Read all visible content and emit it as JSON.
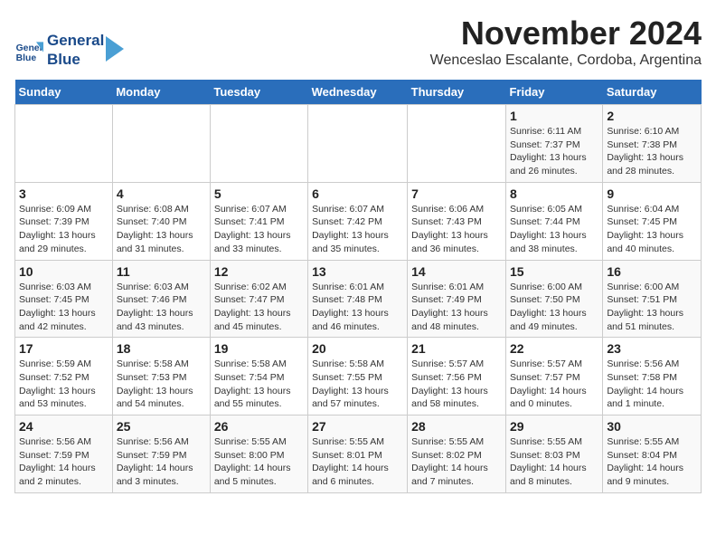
{
  "logo": {
    "line1": "General",
    "line2": "Blue"
  },
  "title": "November 2024",
  "location": "Wenceslao Escalante, Cordoba, Argentina",
  "days_of_week": [
    "Sunday",
    "Monday",
    "Tuesday",
    "Wednesday",
    "Thursday",
    "Friday",
    "Saturday"
  ],
  "weeks": [
    [
      {
        "day": "",
        "info": ""
      },
      {
        "day": "",
        "info": ""
      },
      {
        "day": "",
        "info": ""
      },
      {
        "day": "",
        "info": ""
      },
      {
        "day": "",
        "info": ""
      },
      {
        "day": "1",
        "info": "Sunrise: 6:11 AM\nSunset: 7:37 PM\nDaylight: 13 hours and 26 minutes."
      },
      {
        "day": "2",
        "info": "Sunrise: 6:10 AM\nSunset: 7:38 PM\nDaylight: 13 hours and 28 minutes."
      }
    ],
    [
      {
        "day": "3",
        "info": "Sunrise: 6:09 AM\nSunset: 7:39 PM\nDaylight: 13 hours and 29 minutes."
      },
      {
        "day": "4",
        "info": "Sunrise: 6:08 AM\nSunset: 7:40 PM\nDaylight: 13 hours and 31 minutes."
      },
      {
        "day": "5",
        "info": "Sunrise: 6:07 AM\nSunset: 7:41 PM\nDaylight: 13 hours and 33 minutes."
      },
      {
        "day": "6",
        "info": "Sunrise: 6:07 AM\nSunset: 7:42 PM\nDaylight: 13 hours and 35 minutes."
      },
      {
        "day": "7",
        "info": "Sunrise: 6:06 AM\nSunset: 7:43 PM\nDaylight: 13 hours and 36 minutes."
      },
      {
        "day": "8",
        "info": "Sunrise: 6:05 AM\nSunset: 7:44 PM\nDaylight: 13 hours and 38 minutes."
      },
      {
        "day": "9",
        "info": "Sunrise: 6:04 AM\nSunset: 7:45 PM\nDaylight: 13 hours and 40 minutes."
      }
    ],
    [
      {
        "day": "10",
        "info": "Sunrise: 6:03 AM\nSunset: 7:45 PM\nDaylight: 13 hours and 42 minutes."
      },
      {
        "day": "11",
        "info": "Sunrise: 6:03 AM\nSunset: 7:46 PM\nDaylight: 13 hours and 43 minutes."
      },
      {
        "day": "12",
        "info": "Sunrise: 6:02 AM\nSunset: 7:47 PM\nDaylight: 13 hours and 45 minutes."
      },
      {
        "day": "13",
        "info": "Sunrise: 6:01 AM\nSunset: 7:48 PM\nDaylight: 13 hours and 46 minutes."
      },
      {
        "day": "14",
        "info": "Sunrise: 6:01 AM\nSunset: 7:49 PM\nDaylight: 13 hours and 48 minutes."
      },
      {
        "day": "15",
        "info": "Sunrise: 6:00 AM\nSunset: 7:50 PM\nDaylight: 13 hours and 49 minutes."
      },
      {
        "day": "16",
        "info": "Sunrise: 6:00 AM\nSunset: 7:51 PM\nDaylight: 13 hours and 51 minutes."
      }
    ],
    [
      {
        "day": "17",
        "info": "Sunrise: 5:59 AM\nSunset: 7:52 PM\nDaylight: 13 hours and 53 minutes."
      },
      {
        "day": "18",
        "info": "Sunrise: 5:58 AM\nSunset: 7:53 PM\nDaylight: 13 hours and 54 minutes."
      },
      {
        "day": "19",
        "info": "Sunrise: 5:58 AM\nSunset: 7:54 PM\nDaylight: 13 hours and 55 minutes."
      },
      {
        "day": "20",
        "info": "Sunrise: 5:58 AM\nSunset: 7:55 PM\nDaylight: 13 hours and 57 minutes."
      },
      {
        "day": "21",
        "info": "Sunrise: 5:57 AM\nSunset: 7:56 PM\nDaylight: 13 hours and 58 minutes."
      },
      {
        "day": "22",
        "info": "Sunrise: 5:57 AM\nSunset: 7:57 PM\nDaylight: 14 hours and 0 minutes."
      },
      {
        "day": "23",
        "info": "Sunrise: 5:56 AM\nSunset: 7:58 PM\nDaylight: 14 hours and 1 minute."
      }
    ],
    [
      {
        "day": "24",
        "info": "Sunrise: 5:56 AM\nSunset: 7:59 PM\nDaylight: 14 hours and 2 minutes."
      },
      {
        "day": "25",
        "info": "Sunrise: 5:56 AM\nSunset: 7:59 PM\nDaylight: 14 hours and 3 minutes."
      },
      {
        "day": "26",
        "info": "Sunrise: 5:55 AM\nSunset: 8:00 PM\nDaylight: 14 hours and 5 minutes."
      },
      {
        "day": "27",
        "info": "Sunrise: 5:55 AM\nSunset: 8:01 PM\nDaylight: 14 hours and 6 minutes."
      },
      {
        "day": "28",
        "info": "Sunrise: 5:55 AM\nSunset: 8:02 PM\nDaylight: 14 hours and 7 minutes."
      },
      {
        "day": "29",
        "info": "Sunrise: 5:55 AM\nSunset: 8:03 PM\nDaylight: 14 hours and 8 minutes."
      },
      {
        "day": "30",
        "info": "Sunrise: 5:55 AM\nSunset: 8:04 PM\nDaylight: 14 hours and 9 minutes."
      }
    ]
  ]
}
